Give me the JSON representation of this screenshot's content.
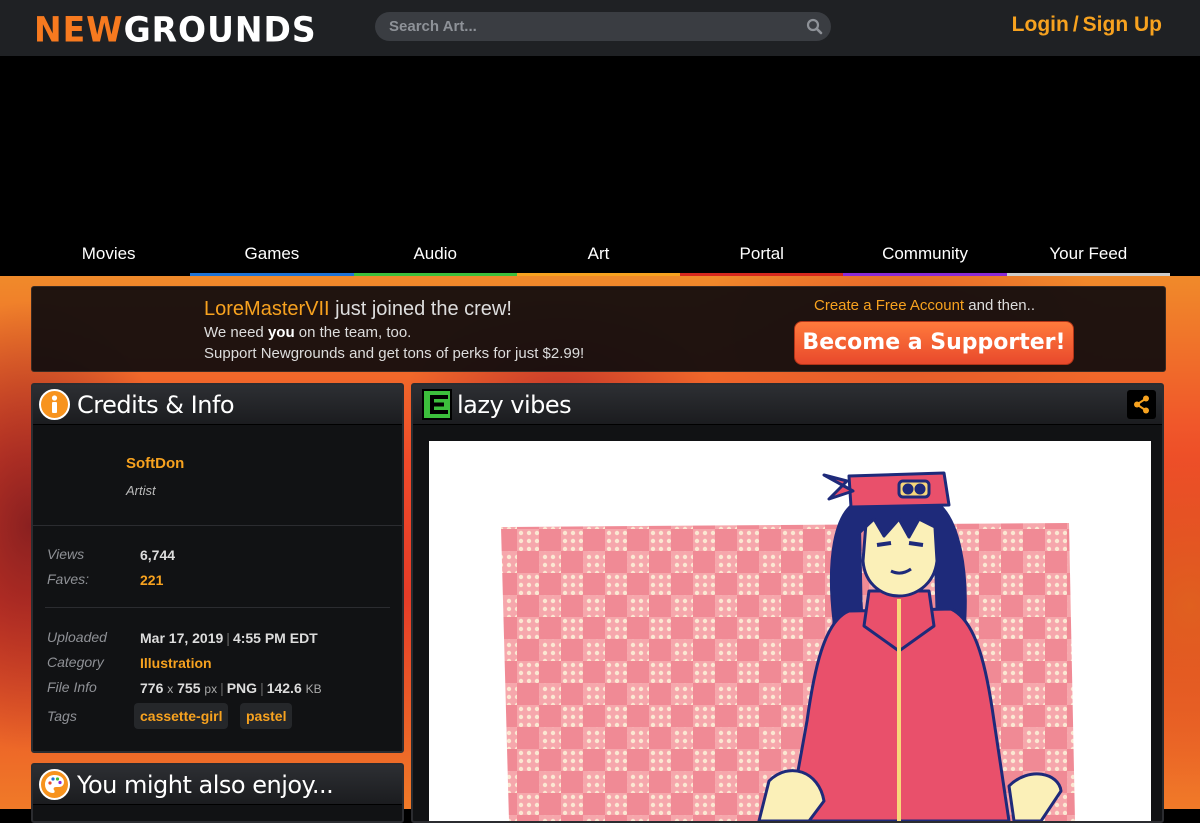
{
  "header": {
    "logo_new": "NEW",
    "logo_grounds": "GROUNDS",
    "search_placeholder": "Search Art...",
    "login": "Login",
    "separator": "/",
    "signup": "Sign Up"
  },
  "nav": {
    "items": [
      {
        "label": "Movies",
        "color": "#000000"
      },
      {
        "label": "Games",
        "color": "#1e73d6"
      },
      {
        "label": "Audio",
        "color": "#3cbf3c"
      },
      {
        "label": "Art",
        "color": "#f7a21f"
      },
      {
        "label": "Portal",
        "color": "#d6281e"
      },
      {
        "label": "Community",
        "color": "#8a2ad6"
      },
      {
        "label": "Your Feed",
        "color": "#cccccc"
      }
    ]
  },
  "promo": {
    "username": "LoreMasterVII",
    "joined_text": " just joined the crew!",
    "line2_pre": "We need ",
    "line2_bold": "you",
    "line2_post": " on the team, too.",
    "line3": "Support Newgrounds and get tons of perks for just $2.99!",
    "create_link": "Create a Free Account",
    "and_then": " and then..",
    "button": "Become a Supporter!"
  },
  "credits": {
    "title": "Credits & Info",
    "artist_name": "SoftDon",
    "artist_role": "Artist",
    "views_label": "Views",
    "views": "6,744",
    "faves_label": "Faves:",
    "faves": "221",
    "uploaded_label": "Uploaded",
    "uploaded_date": "Mar 17, 2019",
    "uploaded_time": "4:55 PM EDT",
    "category_label": "Category",
    "category": "Illustration",
    "fileinfo_label": "File Info",
    "dims_w": "776",
    "dims_x": "x",
    "dims_h": "755",
    "dims_unit": "px",
    "format": "PNG",
    "size": "142.6",
    "size_unit": "KB",
    "tags_label": "Tags",
    "tags": [
      "cassette-girl",
      "pastel"
    ]
  },
  "enjoy": {
    "title": "You might also enjoy..."
  },
  "art": {
    "title": "lazy vibes"
  }
}
